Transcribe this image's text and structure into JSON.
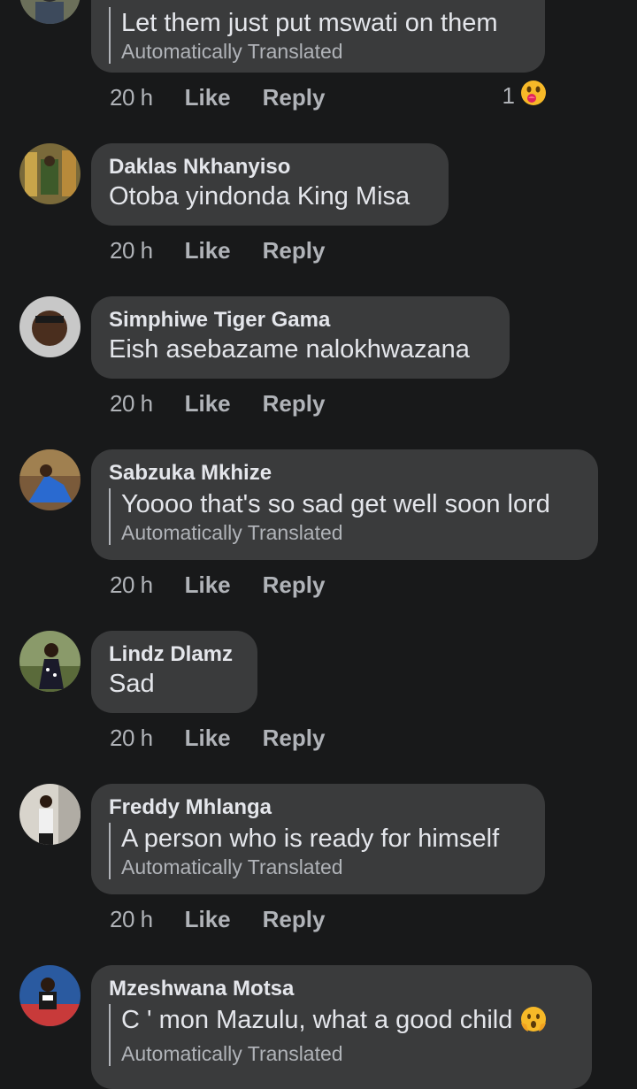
{
  "comments": [
    {
      "author": "",
      "text": "Let them just put mswati on them",
      "translated_label": "Automatically Translated",
      "time": "20 h",
      "like_label": "Like",
      "reply_label": "Reply",
      "reaction_count": "1",
      "reaction_icon": "wow-face-icon"
    },
    {
      "author": "Daklas Nkhanyiso",
      "text": "Otoba yindonda King Misa",
      "time": "20 h",
      "like_label": "Like",
      "reply_label": "Reply"
    },
    {
      "author": "Simphiwe Tiger Gama",
      "text": "Eish asebazame nalokhwazana",
      "time": "20 h",
      "like_label": "Like",
      "reply_label": "Reply"
    },
    {
      "author": "Sabzuka Mkhize",
      "text": "Yoooo that's so sad get well soon lord",
      "translated_label": "Automatically Translated",
      "time": "20 h",
      "like_label": "Like",
      "reply_label": "Reply"
    },
    {
      "author": "Lindz Dlamz",
      "text": "Sad",
      "time": "20 h",
      "like_label": "Like",
      "reply_label": "Reply"
    },
    {
      "author": "Freddy Mhlanga",
      "text": "A person who is ready for himself",
      "translated_label": "Automatically Translated",
      "time": "20 h",
      "like_label": "Like",
      "reply_label": "Reply"
    },
    {
      "author": "Mzeshwana Motsa",
      "text": "C ' mon Mazulu, what a good child",
      "text_emoji": "face-with-hands-icon",
      "translated_label": "Automatically Translated"
    }
  ],
  "colors": {
    "background": "#18191a",
    "bubble": "#3a3b3c",
    "primary_text": "#e4e6eb",
    "secondary_text": "#b0b3b8"
  }
}
